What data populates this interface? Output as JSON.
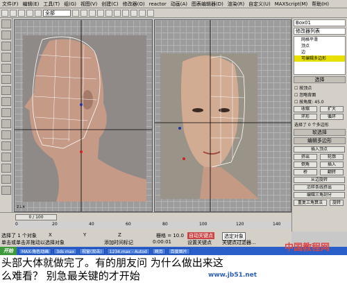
{
  "menu": {
    "items": [
      "文件(F)",
      "编辑(E)",
      "工具(T)",
      "组(G)",
      "视图(V)",
      "创建(C)",
      "修改器(O)",
      "reactor",
      "动画(A)",
      "图表编辑器(D)",
      "渲染(R)",
      "自定义(U)",
      "MAXScript(M)",
      "帮助(H)"
    ]
  },
  "toolbar": {
    "filter": "全部"
  },
  "left_viewport": {
    "frame": "0 / 100"
  },
  "panel": {
    "object_name": "Box01",
    "modifier_list": "修改器列表",
    "stack": [
      "网格平滑",
      "顶点",
      "边",
      "可编辑多边形"
    ],
    "selection_title": "选择",
    "checks": [
      "按顶点",
      "忽略背面",
      "按角度:"
    ],
    "angle": "45.0",
    "shrink": "收缩",
    "grow": "扩大",
    "ring": "环形",
    "loop": "循环",
    "selected_info": "选择了 0 个多边形",
    "soft_sel": "软选择",
    "edit_poly": "编辑多边形",
    "insert_vertex": "插入顶点",
    "buttons": [
      "挤出",
      "轮廓",
      "倒角",
      "插入",
      "桥",
      "翻转",
      "从边旋转",
      "沿样条线挤出",
      "编辑三角剖分",
      "重复三角算法",
      "旋转"
    ]
  },
  "ruler": {
    "ticks": [
      "0",
      "20",
      "40",
      "60",
      "80",
      "100",
      "120",
      "140"
    ]
  },
  "status": {
    "selected": "选择了 1 个对象",
    "x_label": "X",
    "y_label": "Y",
    "z_label": "Z",
    "grid": "栅格 = 10.0",
    "autokey": "自动关键点",
    "set_key": "设置关键点",
    "selected_mode": "选定对象",
    "key_filter": "关键点过滤器...",
    "add_time": "添加时间标记",
    "hint": "单击或单击并拖动以选择对象",
    "frame": "0:00:01"
  },
  "taskbar": {
    "start": "开始",
    "tasks": [
      "MAX-角色动画",
      "3ds max",
      "视窗(双击)",
      "1234.max - Autod",
      "网页",
      "百度图片"
    ]
  },
  "caption": {
    "line1": "头部大体就做完了。有的朋友问 为什么做出来这",
    "line2": "么难看？    别急最关键的才开始"
  },
  "watermarks": {
    "site": "www.jb51.net",
    "logo": "中国教程网"
  }
}
